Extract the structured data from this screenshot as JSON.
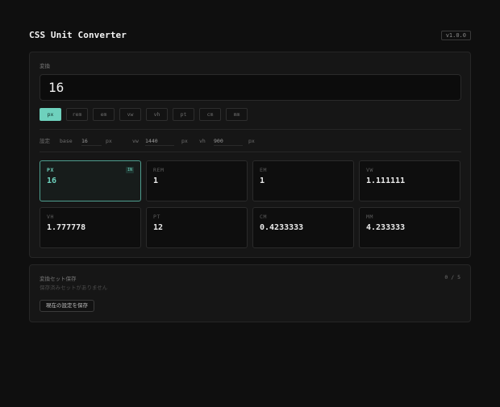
{
  "app": {
    "title": "CSS Unit Converter",
    "version": "v1.0.0"
  },
  "converter": {
    "label": "変換",
    "input_value": "16",
    "units": [
      "px",
      "rem",
      "em",
      "vw",
      "vh",
      "pt",
      "cm",
      "mm"
    ],
    "active_unit": "px"
  },
  "settings": {
    "label": "設定",
    "base": {
      "label": "base",
      "value": "16",
      "unit": "px"
    },
    "vw": {
      "label": "vw",
      "value": "1440",
      "unit": "px"
    },
    "vh": {
      "label": "vh",
      "value": "900",
      "unit": "px"
    }
  },
  "results": [
    {
      "unit": "PX",
      "value": "16",
      "badge": "IN",
      "active": true
    },
    {
      "unit": "REM",
      "value": "1"
    },
    {
      "unit": "EM",
      "value": "1"
    },
    {
      "unit": "VW",
      "value": "1.111111"
    },
    {
      "unit": "VH",
      "value": "1.777778"
    },
    {
      "unit": "PT",
      "value": "12"
    },
    {
      "unit": "CM",
      "value": "0.4233333"
    },
    {
      "unit": "MM",
      "value": "4.233333"
    }
  ],
  "saved": {
    "title": "変換セット保存",
    "count": "0 / 5",
    "empty_text": "保存済みセットがありません",
    "save_label": "現在の設定を保存"
  },
  "colors": {
    "accent": "#6ed1bd",
    "background": "#0f0f0f",
    "panel": "#161616"
  }
}
